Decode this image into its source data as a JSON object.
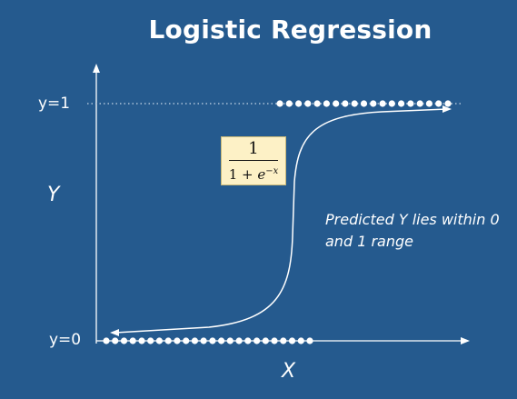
{
  "title": "Logistic Regression",
  "axis": {
    "y_label": "Y",
    "x_label": "X"
  },
  "levels": {
    "top": "y=1",
    "bottom": "y=0"
  },
  "formula": {
    "numerator": "1",
    "denominator_prefix": "1 + ",
    "base": "e",
    "exponent": "−x"
  },
  "annotation": "Predicted Y lies within 0 and 1 range",
  "colors": {
    "background": "#255a8e",
    "foreground": "#ffffff",
    "formula_bg": "#fdf1c6"
  },
  "points": {
    "top_count": 19,
    "bottom_count": 24
  }
}
